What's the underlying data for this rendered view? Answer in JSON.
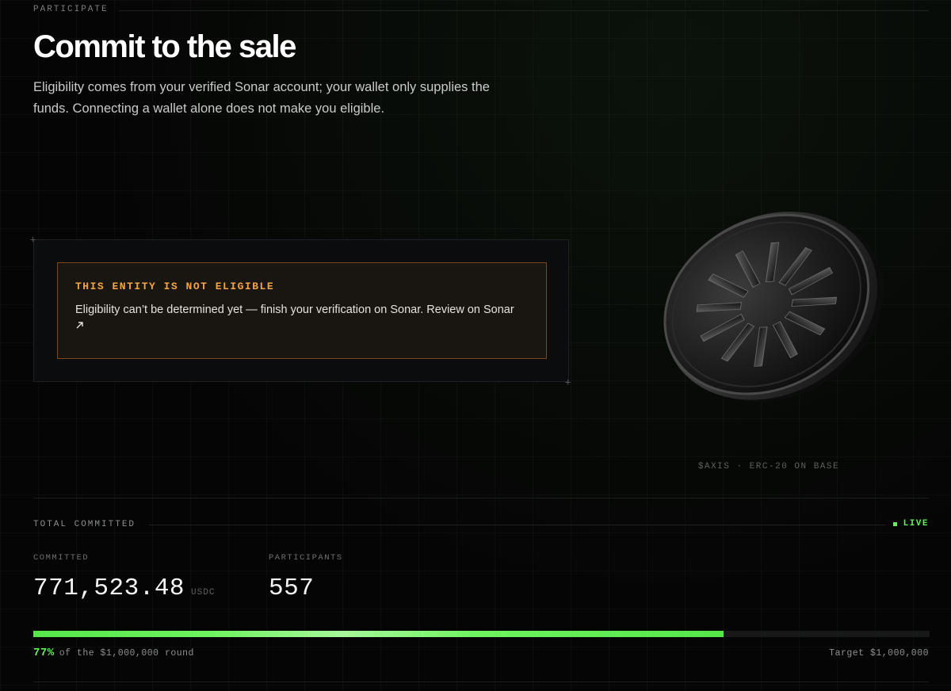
{
  "header": {
    "eyebrow": "PARTICIPATE",
    "title": "Commit to the sale",
    "subtitle": "Eligibility comes from your verified Sonar account; your wallet only supplies the funds. Connecting a wallet alone does not make you eligible."
  },
  "eligibility": {
    "title": "THIS ENTITY IS NOT ELIGIBLE",
    "message": "Eligibility can’t be determined yet — finish your verification on Sonar.",
    "link_label": "Review on Sonar",
    "link_icon": "arrow-up-right-icon"
  },
  "token": {
    "caption": "$AXIS · ERC-20 ON BASE",
    "icon": "starburst-coin"
  },
  "stats": {
    "section_label": "TOTAL COMMITTED",
    "live_label": "LIVE",
    "committed_label": "COMMITTED",
    "committed_value": "771,523.48",
    "committed_unit": "USDC",
    "participants_label": "PARTICIPANTS",
    "participants_value": "557",
    "progress_percent": 77,
    "progress_label": "77%",
    "progress_suffix": "of the $1,000,000 round",
    "target_label": "Target $1,000,000"
  },
  "colors": {
    "accent_green": "#66f05a",
    "warning_orange": "#f2a545",
    "background": "#050505"
  }
}
